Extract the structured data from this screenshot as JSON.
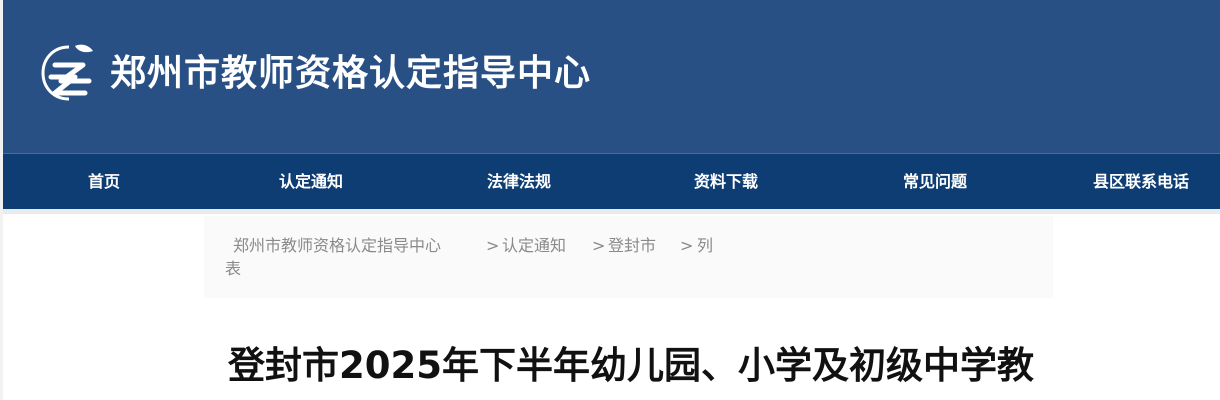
{
  "header": {
    "site_title": "郑州市教师资格认定指导中心",
    "logo_icon": "zz-leaf-logo-icon",
    "background_color": "#295085"
  },
  "nav": {
    "background_color": "#0e3d73",
    "items": [
      {
        "label": "首页"
      },
      {
        "label": "认定通知"
      },
      {
        "label": "法律法规"
      },
      {
        "label": "资料下载"
      },
      {
        "label": "常见问题"
      },
      {
        "label": "县区联系电话"
      }
    ]
  },
  "breadcrumb": {
    "items": [
      {
        "label": "郑州市教师资格认定指导中心"
      },
      {
        "label": "认定通知"
      },
      {
        "label": "登封市"
      }
    ],
    "separator": ">",
    "last_part1": "列",
    "last_part2": "表"
  },
  "article": {
    "title": "登封市2025年下半年幼儿园、小学及初级中学教"
  }
}
